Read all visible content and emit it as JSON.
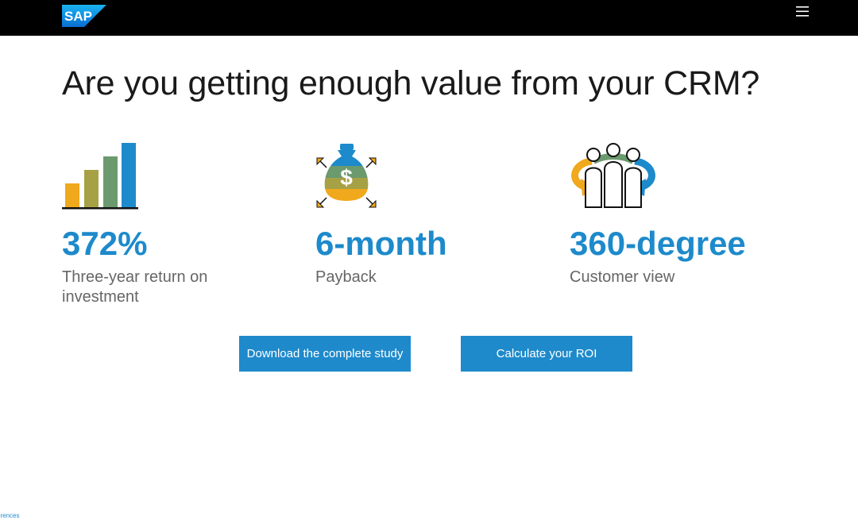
{
  "header": {
    "logo_text": "SAP",
    "logo_icon": "sap-logo",
    "menu_icon": "hamburger-menu-icon"
  },
  "main": {
    "headline": "Are you getting enough value from your CRM?",
    "stats": [
      {
        "icon": "bar-chart-icon",
        "value": "372%",
        "label": "Three-year return on investment"
      },
      {
        "icon": "money-bag-icon",
        "value": "6-month",
        "label": "Payback"
      },
      {
        "icon": "customers-cycle-icon",
        "value": "360-degree",
        "label": "Customer view"
      }
    ],
    "buttons": {
      "download_label": "Download the complete study",
      "roi_label": "Calculate your ROI"
    }
  },
  "footer": {
    "preferences_text": "erences"
  },
  "colors": {
    "accent": "#1e8acb",
    "topbar": "#000000",
    "gold": "#f0a81c",
    "olive": "#a7a145",
    "green": "#6b9a6e"
  }
}
